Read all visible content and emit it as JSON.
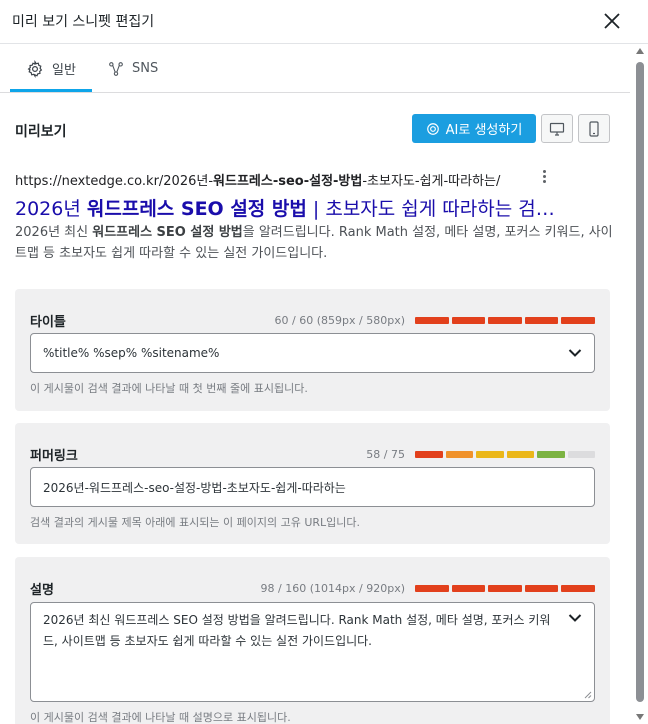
{
  "header": {
    "title": "미리 보기 스니펫 편집기"
  },
  "tabs": [
    {
      "label": "일반"
    },
    {
      "label": "SNS"
    }
  ],
  "preview": {
    "label": "미리보기",
    "ai_button": "AI로 생성하기",
    "url": "https://nextedge.co.kr/2026년-워드프레스-seo-설정-방법-초보자도-쉽게-따라하는/",
    "url_prefix": "https://nextedge.co.kr/2026년-",
    "url_bold": "워드프레스-seo-설정-방법",
    "url_suffix": "-초보자도-쉽게-따라하는/",
    "title_prefix": "2026년 ",
    "title_bold": "워드프레스 SEO 설정 방법",
    "title_suffix": " | 초보자도 쉽게 따라하는 검…",
    "desc_prefix": "2026년 최신 ",
    "desc_bold": "워드프레스 SEO 설정 방법",
    "desc_suffix": "을 알려드립니다. Rank Math 설정, 메타 설명, 포커스 키워드, 사이트맵 등 초보자도 쉽게 따라할 수 있는 실전 가이드입니다."
  },
  "title_field": {
    "label": "타이틀",
    "counter": "60 / 60 (859px / 580px)",
    "value": "%title% %sep% %sitename%",
    "help": "이 게시물이 검색 결과에 나타날 때 첫 번째 줄에 표시됩니다.",
    "meter_colors": [
      "#e2401c",
      "#e2401c",
      "#e2401c",
      "#e2401c",
      "#e2401c"
    ]
  },
  "permalink_field": {
    "label": "퍼머링크",
    "counter": "58 / 75",
    "value": "2026년-워드프레스-seo-설정-방법-초보자도-쉽게-따라하는",
    "help": "검색 결과의 게시물 제목 아래에 표시되는 이 페이지의 고유 URL입니다.",
    "meter_colors": [
      "#e2401c",
      "#f0922b",
      "#ebb71a",
      "#ebb71a",
      "#7cb342",
      "#dcdcde"
    ]
  },
  "description_field": {
    "label": "설명",
    "counter": "98 / 160 (1014px / 920px)",
    "value": "2026년 최신 워드프레스 SEO 설정 방법을 알려드립니다. Rank Math 설정, 메타 설명, 포커스 키워드, 사이트맵 등 초보자도 쉽게 따라할 수 있는 실전 가이드입니다.",
    "help": "이 게시물이 검색 결과에 나타날 때 설명으로 표시됩니다.",
    "meter_colors": [
      "#e2401c",
      "#e2401c",
      "#e2401c",
      "#e2401c",
      "#e2401c"
    ]
  },
  "icons": {
    "close": "close-icon",
    "general_tab": "gear-icon",
    "sns_tab": "share-icon",
    "ai": "ai-sparkle-icon",
    "desktop": "desktop-icon",
    "mobile": "mobile-icon",
    "more": "more-vertical-icon",
    "dropdown": "chevron-down-icon"
  },
  "colors": {
    "accent": "#1b9ee0",
    "tab_underline": "#0ea5e9",
    "serp_title": "#1a0dab",
    "card_bg": "#f0f0f1"
  }
}
